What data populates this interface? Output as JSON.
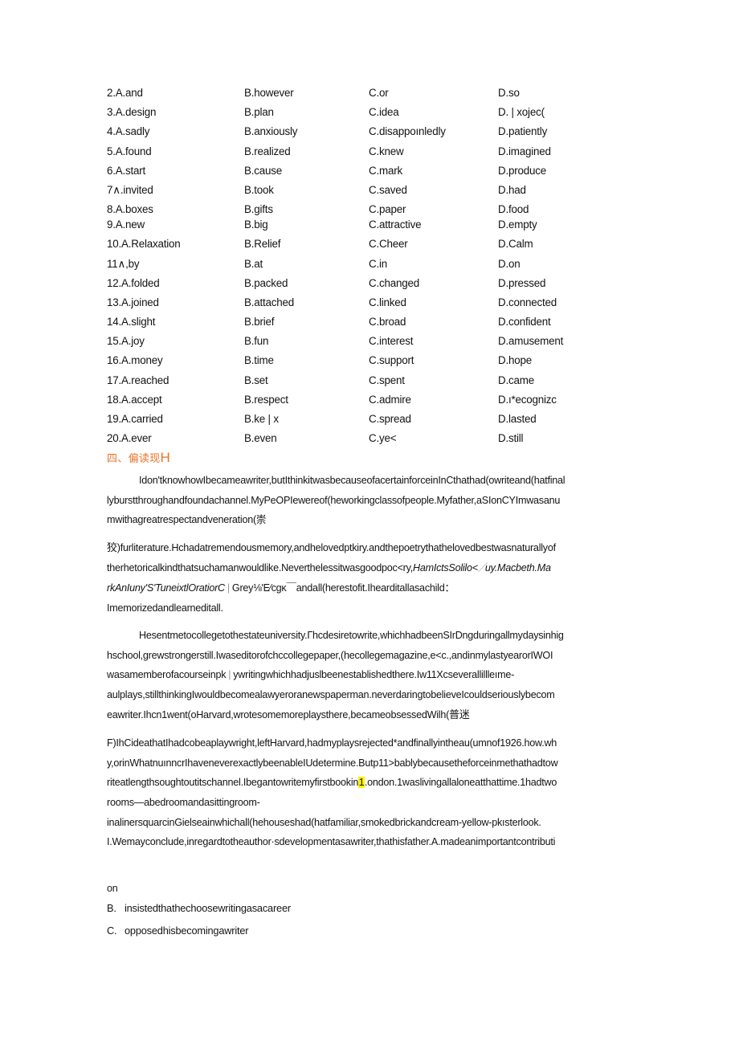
{
  "cloze": {
    "rows": [
      {
        "num": "2",
        "a": "2.A.and",
        "b": "B.however",
        "c": "C.or",
        "d": "D.so",
        "tight": false
      },
      {
        "num": "3",
        "a": "3.A.design",
        "b": "B.plan",
        "c": "C.idea",
        "d": "D. | xojec(",
        "tight": false
      },
      {
        "num": "4",
        "a": "4.A.sadly",
        "b": "B.anxiously",
        "c": "C.disappoınledly",
        "d": "D.patiently",
        "tight": false
      },
      {
        "num": "5",
        "a": "5.A.found",
        "b": "B.realized",
        "c": "C.knew",
        "d": "D.imagined",
        "tight": false
      },
      {
        "num": "6",
        "a": "6.A.start",
        "b": "B.cause",
        "c": "C.mark",
        "d": "D.produce",
        "tight": false
      },
      {
        "num": "7",
        "a": "7∧.invited",
        "b": "B.took",
        "c": "C.saved",
        "d": "D.had",
        "tight": false
      },
      {
        "num": "8",
        "a": "8.A.boxes",
        "b": "B.gifts",
        "c": "C.paper",
        "d": "D.food",
        "tight": true
      },
      {
        "num": "9",
        "a": "9.A.new",
        "b": "B.big",
        "c": "C.attractive",
        "d": "D.empty",
        "tight": false
      },
      {
        "num": "10",
        "a": "10.A.Relaxation",
        "b": "B.Relief",
        "c": "C.Cheer",
        "d": "D.Calm",
        "tight": false
      },
      {
        "num": "11",
        "a": "11∧,by",
        "b": "B.at",
        "c": "C.in",
        "d": "D.on",
        "tight": false
      },
      {
        "num": "12",
        "a": "12.A.folded",
        "b": "B.packed",
        "c": "C.changed",
        "d": "D.pressed",
        "tight": false
      },
      {
        "num": "13",
        "a": "13.A.joined",
        "b": "B.attached",
        "c": "C.linked",
        "d": "D.connected",
        "tight": false
      },
      {
        "num": "14",
        "a": "14.A.slight",
        "b": "B.brief",
        "c": "C.broad",
        "d": "D.confident",
        "tight": false
      },
      {
        "num": "15",
        "a": "15.A.joy",
        "b": "B.fun",
        "c": "C.interest",
        "d": "D.amusement",
        "tight": false
      },
      {
        "num": "16",
        "a": "16.A.money",
        "b": "B.time",
        "c": "C.support",
        "d": "D.hope",
        "tight": false
      },
      {
        "num": "17",
        "a": "17.A.reached",
        "b": "B.set",
        "c": "C.spent",
        "d": "D.came",
        "tight": false
      },
      {
        "num": "18",
        "a": "18.A.accept",
        "b": "B.respect",
        "c": "C.admire",
        "d": "D.ı*ecognizc",
        "tight": false
      },
      {
        "num": "19",
        "a": "19.A.carried",
        "b": "B.ke | x",
        "c": "C.spread",
        "d": "D.lasted",
        "tight": false
      },
      {
        "num": "20",
        "a": "20.A.ever",
        "b": "B.even",
        "c": "C.ye<",
        "d": "D.still",
        "tight": false
      }
    ]
  },
  "section": {
    "heading_cjk": "四、偏读现",
    "heading_tail": "H"
  },
  "passage": {
    "line1": "Idon'tknowhowIbecameawriter,butIthinkitwasbecauseofacertainforceinInCthathad(owriteand(hatfinal",
    "line2": "lyburstthroughandfoundachannel.MyPeOPIewereof(heworkingclassofpeople.Myfather,aSIonCYImwasanu",
    "line3": "mwithagreatrespectandveneration(崇",
    "line4_cjk": "狡",
    "line4": ")furliterature.Hchadatremendousmemory,andhelovedptkiry.andthepoetrythathelovedbestwasnaturallyof",
    "line5": "therhetoricalkindthatsuchamanwouldlike.Neverthelessitwasgoodpoc<ry,",
    "line5_ital": "HamIctsSolilo<",
    "line5_mid": "／",
    "line5_ital2": "uy.Macbeth.Ma",
    "line6_ital": "rkAnIuny'S'TuneixtlOratiorC",
    "line6": "Grey⅛'E⁄cgκ￣andall(herestofit.Ihearditallasachild：",
    "line7": "Imemorizedandlearneditall.",
    "line8": "Hesentmetocollegetothestateuniversity.Гhcdesiretowrite,whichhadbeenSIrDngduringallmydaysinhig",
    "line9": "hschool,grewstrongerstill.Iwaseditorofchccollegepaper,(hecollegemagazine,e<c.,andinmylastyearorIWOI",
    "line10a": "wasamemberofacourseinpk",
    "line10b": "ywritingwhichhadjuslbeenestablishedthere.Iw11Xcseverallillleıme-",
    "line11": "aulplays,stillthinkingIwouldbecomealawyeroranewspaperman.neverdaringtobelieveIcouldseriouslybecom",
    "line12": "eawriter.Ihcn1went(oHarvard,wrotesomemoreplaysthere,becameobsessedWilh(",
    "line12_cjk": "普迷",
    "line13": "F)IhCideathatIhadcobeaplaywright,leftHarvard,hadmyplaysrejected*andfinallyintheau(umnof1926.how.wh",
    "line14": "y,orinWhatnuınncrIhaveneverexactlybeenableIUdetermine.Butp11>bablybecausetheforceinmethathadtow",
    "line15a": "riteatlengthsoughtoutitschannel.Ibegantowritemyfirstbookin",
    "line15_hl": "1",
    "line15b": ".ondon.1waslivingallaloneatthattime.1hadtwo",
    "line16": "rooms—abedroomandasittingroom-",
    "line17": "inalinersquarcinGielseainwhichall(hehouseshad(hatfamiliar,smokedbrickandcream-yellow-pkısterlook.",
    "line18": "I.Wemayconclude,inregardtotheauthor·sdevelopmentasawriter,thathisfather.A.madeanimportantcontributi"
  },
  "answers": {
    "continuation": "on",
    "b_label": "B.",
    "b_text": "insistedthathechoosewritingasacareer",
    "c_label": "C.",
    "c_text": "opposedhisbecomingawriter"
  }
}
